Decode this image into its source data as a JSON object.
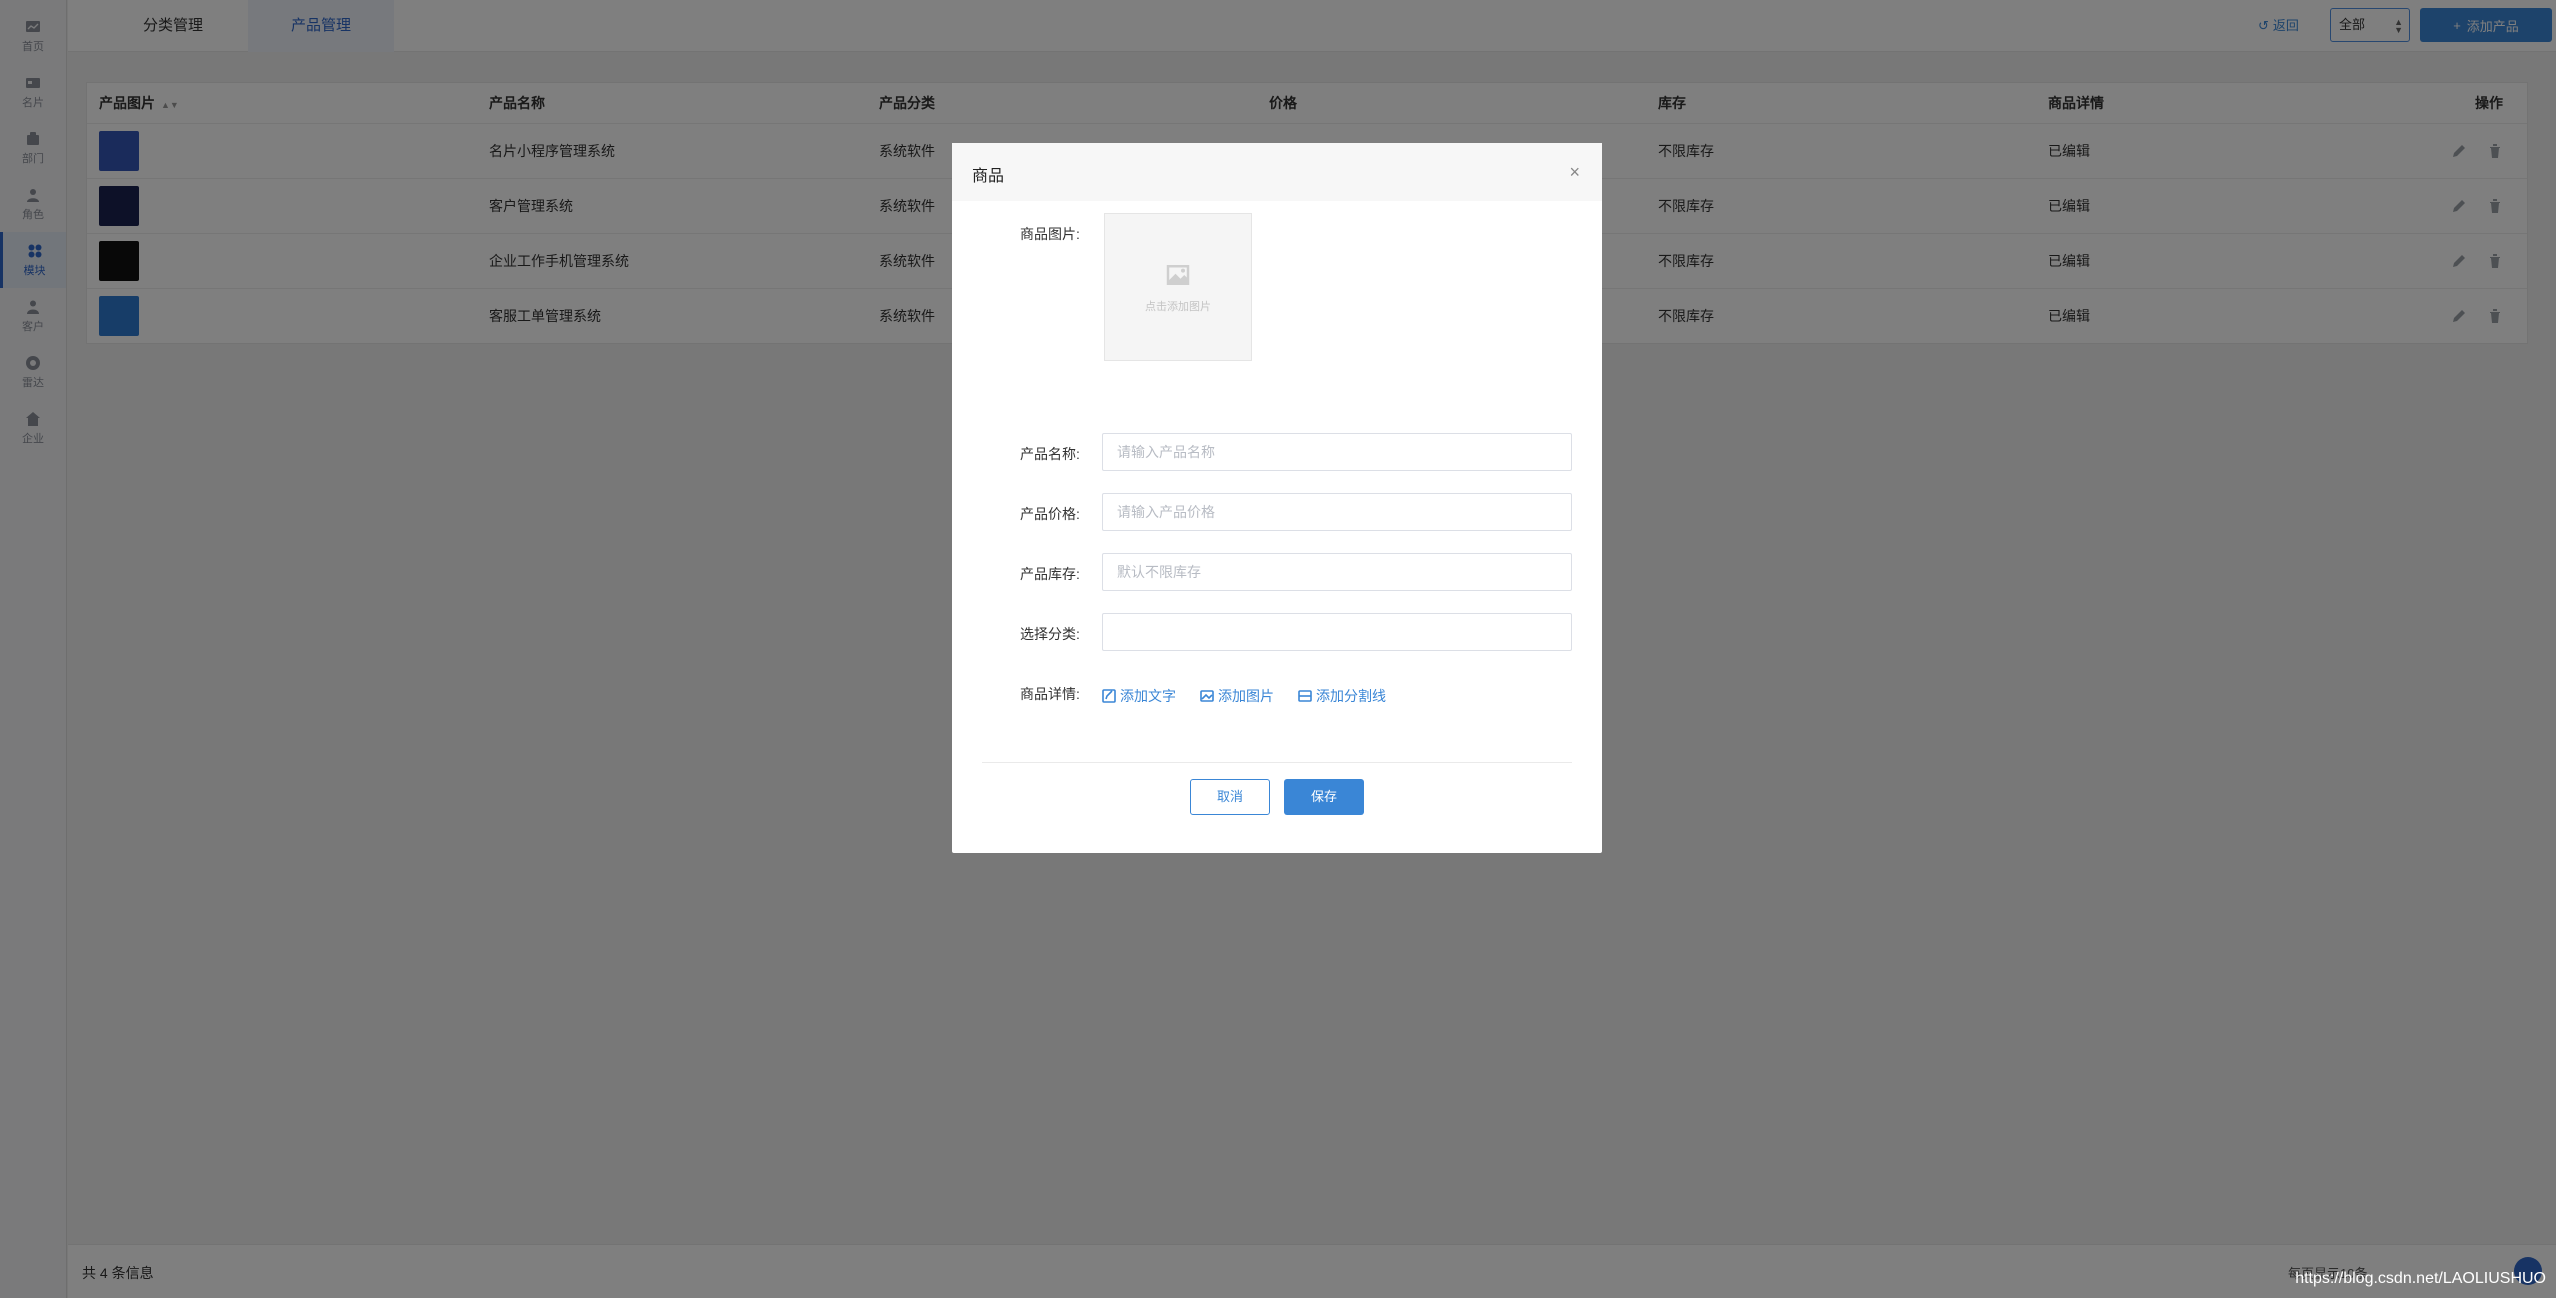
{
  "sidebar": {
    "items": [
      {
        "label": "首页",
        "icon": "chart-icon",
        "active": false
      },
      {
        "label": "名片",
        "icon": "card-icon",
        "active": false
      },
      {
        "label": "部门",
        "icon": "department-icon",
        "active": false
      },
      {
        "label": "角色",
        "icon": "role-icon",
        "active": false
      },
      {
        "label": "模块",
        "icon": "module-icon",
        "active": true
      },
      {
        "label": "客户",
        "icon": "customer-icon",
        "active": false
      },
      {
        "label": "雷达",
        "icon": "radar-icon",
        "active": false
      },
      {
        "label": "企业",
        "icon": "company-icon",
        "active": false
      }
    ]
  },
  "topbar": {
    "tabs": [
      "分类管理",
      "产品管理"
    ],
    "back_label": "返回",
    "filter_value": "全部",
    "add_label": "添加产品"
  },
  "table": {
    "headers": [
      "产品图片",
      "产品名称",
      "产品分类",
      "价格",
      "库存",
      "商品详情",
      "操作"
    ],
    "rows": [
      {
        "name": "名片小程序管理系统",
        "category": "系统软件",
        "price": "",
        "stock": "不限库存",
        "detail": "已编辑",
        "thumb_color": "#3557b7"
      },
      {
        "name": "客户管理系统",
        "category": "系统软件",
        "price": "",
        "stock": "不限库存",
        "detail": "已编辑",
        "thumb_color": "#1b2350"
      },
      {
        "name": "企业工作手机管理系统",
        "category": "系统软件",
        "price": "",
        "stock": "不限库存",
        "detail": "已编辑",
        "thumb_color": "#111111"
      },
      {
        "name": "客服工单管理系统",
        "category": "系统软件",
        "price": "",
        "stock": "不限库存",
        "detail": "已编辑",
        "thumb_color": "#2f7bd0"
      }
    ]
  },
  "footer": {
    "total": "共 4 条信息",
    "pager": "每页显示10条"
  },
  "modal": {
    "title": "商品",
    "image_label": "商品图片:",
    "upload_hint": "点击添加图片",
    "name_label": "产品名称:",
    "name_placeholder": "请输入产品名称",
    "price_label": "产品价格:",
    "price_placeholder": "请输入产品价格",
    "stock_label": "产品库存:",
    "stock_placeholder": "默认不限库存",
    "category_label": "选择分类:",
    "detail_label": "商品详情:",
    "add_text": "添加文字",
    "add_image": "添加图片",
    "add_divider": "添加分割线",
    "cancel": "取消",
    "save": "保存"
  },
  "watermark": "https://blog.csdn.net/LAOLIUSHUO",
  "colors": {
    "accent": "#3a86d6",
    "overlay": "rgba(0,0,0,0.5)"
  }
}
